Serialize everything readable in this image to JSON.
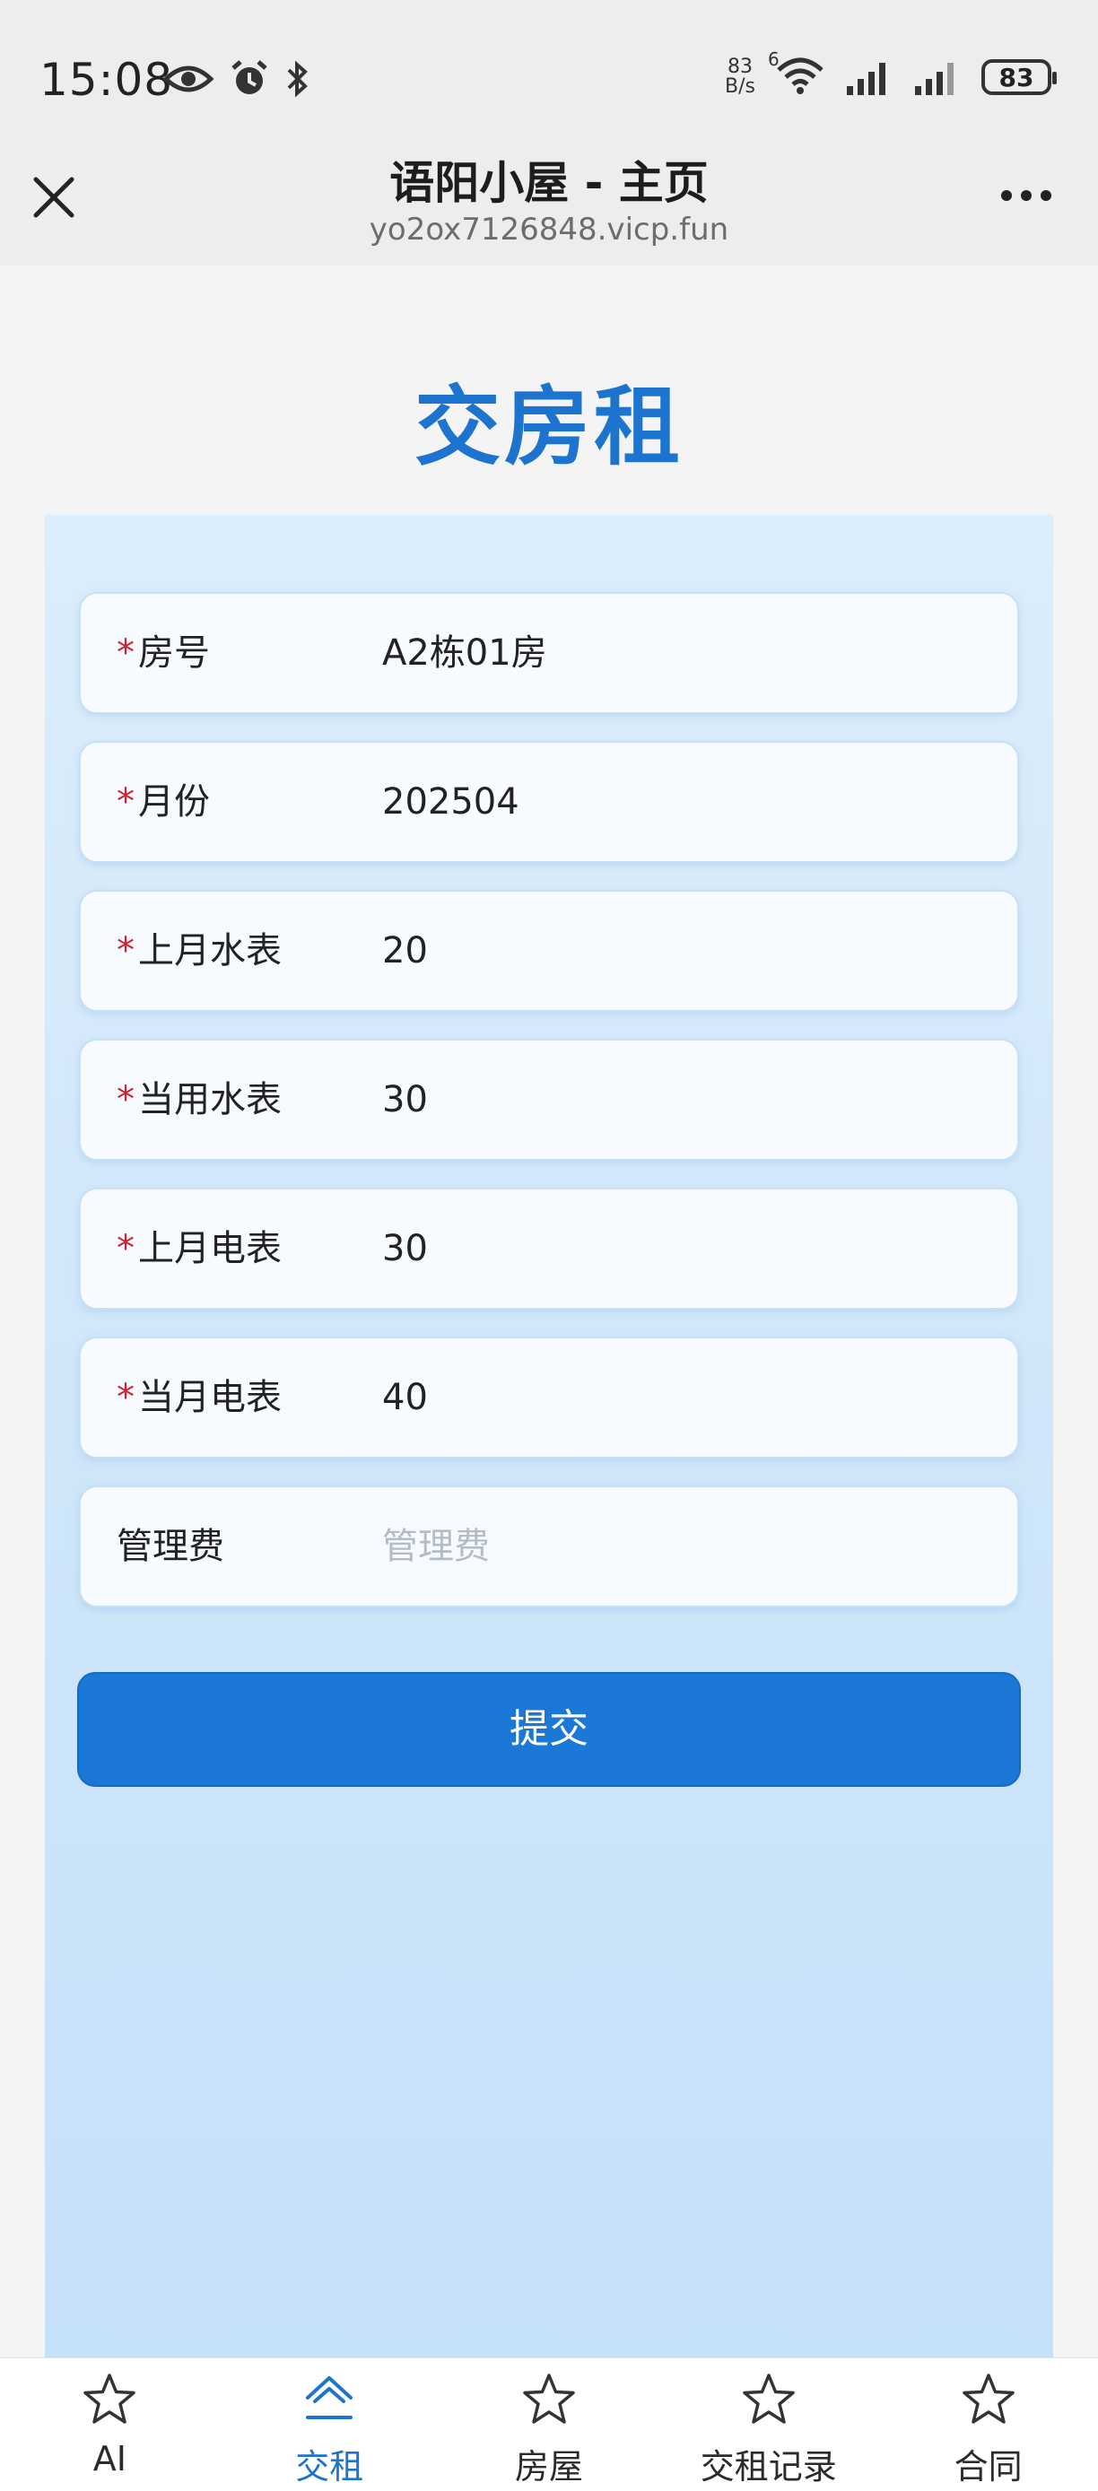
{
  "status_bar": {
    "time": "15:08",
    "net_speed_value": "83",
    "net_speed_unit": "B/s",
    "wifi_badge": "6",
    "battery": "83"
  },
  "header": {
    "title": "语阳小屋 - 主页",
    "url": "yo2ox7126848.vicp.fun"
  },
  "page": {
    "title": "交房租"
  },
  "form": {
    "fields": [
      {
        "label": "房号",
        "required": "*",
        "value": "A2栋01房"
      },
      {
        "label": "月份",
        "required": "*",
        "value": "202504"
      },
      {
        "label": "上月水表",
        "required": "*",
        "value": "20"
      },
      {
        "label": "当用水表",
        "required": "*",
        "value": "30"
      },
      {
        "label": "上月电表",
        "required": "*",
        "value": "30"
      },
      {
        "label": "当月电表",
        "required": "*",
        "value": "40"
      },
      {
        "label": "管理费",
        "required": "",
        "value": "",
        "placeholder": "管理费"
      }
    ],
    "submit_label": "提交"
  },
  "nav": {
    "items": [
      {
        "label": "AI",
        "icon": "star-icon"
      },
      {
        "label": "交租",
        "icon": "home-icon",
        "active": true
      },
      {
        "label": "房屋",
        "icon": "star-icon"
      },
      {
        "label": "交租记录",
        "icon": "star-icon"
      },
      {
        "label": "合同",
        "icon": "star-icon"
      }
    ]
  },
  "colors": {
    "accent": "#1c74cf",
    "button": "#1b78d6",
    "required": "#d3202f"
  }
}
